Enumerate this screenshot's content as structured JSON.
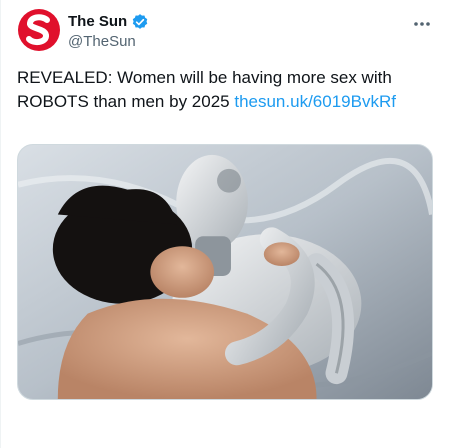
{
  "author": {
    "display_name": "The Sun",
    "handle": "@TheSun",
    "avatar_letter": "S",
    "verified": true,
    "brand_color": "#e0102c"
  },
  "tweet": {
    "text": "REVEALED: Women will be having more sex with ROBOTS than men by 2025",
    "link_text": "thesun.uk/6019BvkRf",
    "link_color": "#1d9bf0"
  },
  "media": {
    "alt": ""
  },
  "icons": {
    "more": "more-horizontal-icon",
    "verified": "verified-badge-icon"
  }
}
